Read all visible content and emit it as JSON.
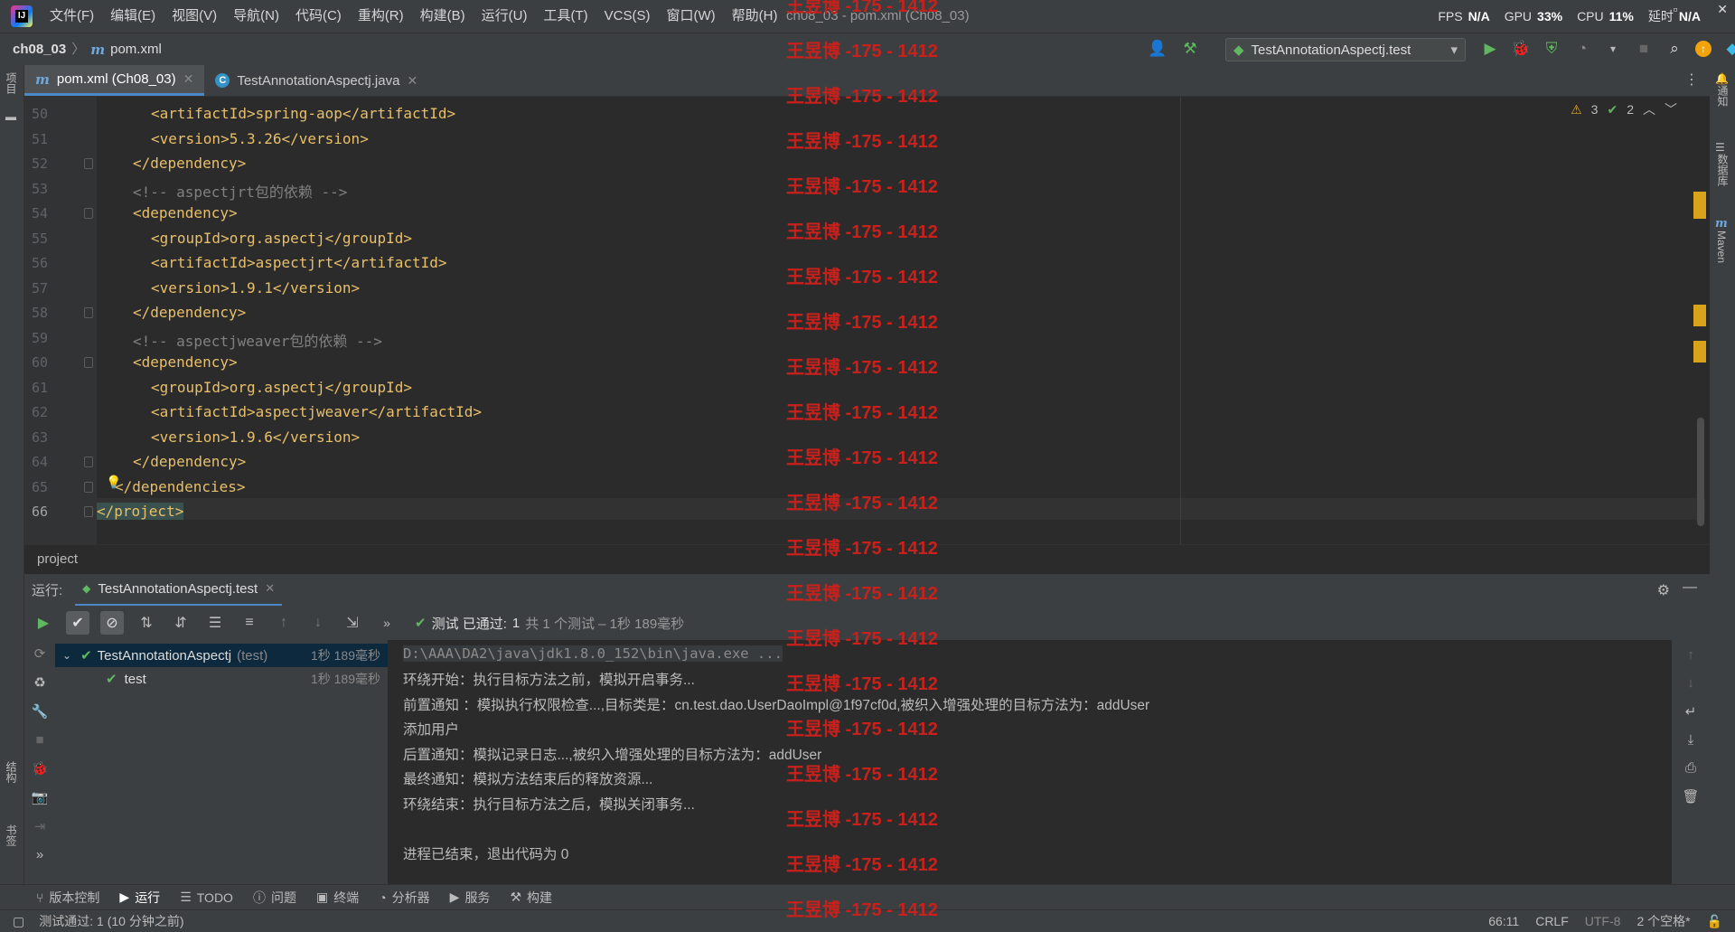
{
  "window": {
    "title": "ch08_03 - pom.xml (Ch08_03)",
    "menu": [
      "文件(F)",
      "编辑(E)",
      "视图(V)",
      "导航(N)",
      "代码(C)",
      "重构(R)",
      "构建(B)",
      "运行(U)",
      "工具(T)",
      "VCS(S)",
      "窗口(W)",
      "帮助(H)"
    ],
    "perf": {
      "fps_label": "FPS",
      "fps": "N/A",
      "gpu_label": "GPU",
      "gpu": "33%",
      "cpu_label": "CPU",
      "cpu": "11%",
      "delay_label": "延时",
      "delay": "N/A"
    }
  },
  "nav": {
    "project": "ch08_03",
    "file": "pom.xml",
    "run_config": "TestAnnotationAspectj.test"
  },
  "tabs": [
    {
      "label": "pom.xml (Ch08_03)",
      "active": true
    },
    {
      "label": "TestAnnotationAspectj.java",
      "active": false
    }
  ],
  "editor": {
    "inspection_warnings": "3",
    "inspection_ok": "2",
    "lines": [
      {
        "no": "50",
        "text": "<artifactId>spring-aop</artifactId>"
      },
      {
        "no": "51",
        "text": "<version>5.3.26</version>"
      },
      {
        "no": "52",
        "text": "</dependency>"
      },
      {
        "no": "53",
        "text": "<!-- aspectjrt包的依赖 -->"
      },
      {
        "no": "54",
        "text": "<dependency>"
      },
      {
        "no": "55",
        "text": "<groupId>org.aspectj</groupId>"
      },
      {
        "no": "56",
        "text": "<artifactId>aspectjrt</artifactId>"
      },
      {
        "no": "57",
        "text": "<version>1.9.1</version>"
      },
      {
        "no": "58",
        "text": "</dependency>"
      },
      {
        "no": "59",
        "text": "<!-- aspectjweaver包的依赖 -->"
      },
      {
        "no": "60",
        "text": "<dependency>"
      },
      {
        "no": "61",
        "text": "<groupId>org.aspectj</groupId>"
      },
      {
        "no": "62",
        "text": "<artifactId>aspectjweaver</artifactId>"
      },
      {
        "no": "63",
        "text": "<version>1.9.6</version>"
      },
      {
        "no": "64",
        "text": "</dependency>"
      },
      {
        "no": "65",
        "text": "</dependencies>"
      },
      {
        "no": "66",
        "text": "</project>"
      }
    ],
    "breadcrumb": "project"
  },
  "run": {
    "label": "运行:",
    "tab": "TestAnnotationAspectj.test",
    "status_prefix": "测试 已通过:",
    "status_count": "1",
    "status_detail": "共 1 个测试 – 1秒 189毫秒",
    "tree": [
      {
        "name": "TestAnnotationAspectj",
        "suffix": "(test)",
        "time": "1秒 189毫秒"
      },
      {
        "name": "test",
        "suffix": "",
        "time": "1秒 189毫秒"
      }
    ],
    "console": [
      "D:\\AAA\\DA2\\java\\jdk1.8.0_152\\bin\\java.exe ...",
      "环绕开始：执行目标方法之前，模拟开启事务...",
      "前置通知 ：模拟执行权限检查...,目标类是：cn.test.dao.UserDaoImpl@1f97cf0d,被织入增强处理的目标方法为：addUser",
      "添加用户",
      "后置通知：模拟记录日志...,被织入增强处理的目标方法为：addUser",
      "最终通知：模拟方法结束后的释放资源...",
      "环绕结束：执行目标方法之后，模拟关闭事务...",
      "",
      "进程已结束，退出代码为 0"
    ]
  },
  "left_stripe": {
    "project": "项目",
    "structure": "结构",
    "bookmarks": "书签"
  },
  "right_stripe": {
    "notifications": "通知",
    "database": "数据库",
    "maven": "Maven"
  },
  "tool_stripe": [
    "版本控制",
    "运行",
    "TODO",
    "问题",
    "终端",
    "分析器",
    "服务",
    "构建"
  ],
  "statusbar": {
    "message": "测试通过: 1 (10 分钟之前)",
    "position": "66:11",
    "line_sep": "CRLF",
    "encoding": "UTF-8",
    "indent": "2 个空格*"
  },
  "watermark": "王昱博 -175 - 1412",
  "colors": {
    "accent": "#4a88c7",
    "tag": "#e8bf6a",
    "pass": "#5fb760",
    "warn": "#e0a630",
    "watermark": "#c8211c"
  }
}
